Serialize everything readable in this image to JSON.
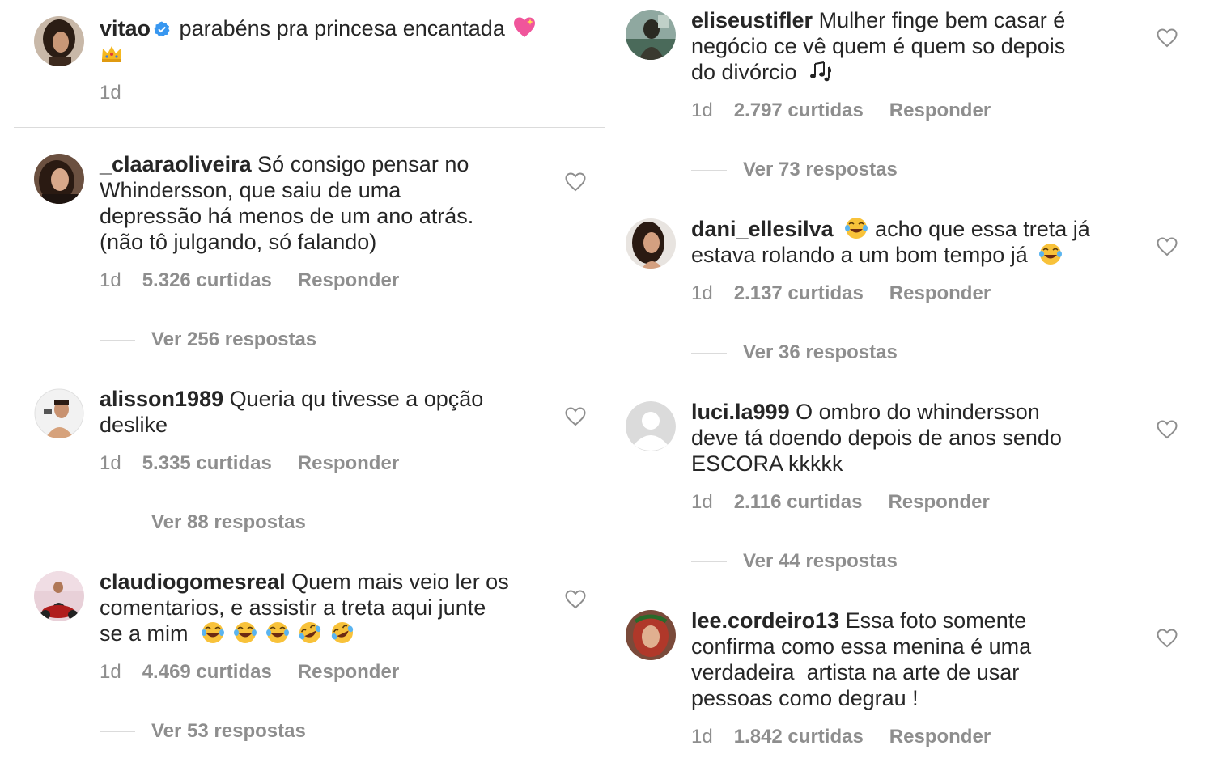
{
  "caption": {
    "username": "vitao",
    "text": "parabéns pra princesa encantada",
    "time": "1d"
  },
  "left_comments": [
    {
      "username": "_claaraoliveira",
      "text_lines": [
        "Só consigo pensar no",
        "Whindersson, que saiu de uma",
        "depressão há menos de um ano atrás.",
        "(não tô julgando, só falando)"
      ],
      "time": "1d",
      "likes": "5.326 curtidas",
      "reply": "Responder",
      "replies": "Ver 256 respostas"
    },
    {
      "username": "alisson1989",
      "text_lines": [
        "Queria qu tivesse a opção",
        "deslike"
      ],
      "time": "1d",
      "likes": "5.335 curtidas",
      "reply": "Responder",
      "replies": "Ver 88 respostas"
    },
    {
      "username": "claudiogomesreal",
      "text_lines": [
        "Quem mais veio ler os",
        "comentarios, e assistir a treta aqui junte",
        "se a mim"
      ],
      "time": "1d",
      "likes": "4.469 curtidas",
      "reply": "Responder",
      "replies": "Ver 53 respostas"
    }
  ],
  "right_comments": [
    {
      "username": "eliseustifler",
      "text_lines": [
        "Mulher finge bem casar é",
        "negócio ce vê quem é quem so depois",
        "do divórcio"
      ],
      "time": "1d",
      "likes": "2.797 curtidas",
      "reply": "Responder",
      "replies": "Ver 73 respostas"
    },
    {
      "username": "dani_ellesilva",
      "text_lines": [
        "acho que essa treta já",
        "estava rolando a um bom tempo já"
      ],
      "time": "1d",
      "likes": "2.137 curtidas",
      "reply": "Responder",
      "replies": "Ver 36 respostas"
    },
    {
      "username": "luci.la999",
      "text_lines": [
        "O ombro do whindersson",
        "deve tá doendo depois de anos sendo",
        "ESCORA kkkkk"
      ],
      "time": "1d",
      "likes": "2.116 curtidas",
      "reply": "Responder",
      "replies": "Ver 44 respostas"
    },
    {
      "username": "lee.cordeiro13",
      "text_lines": [
        "Essa foto somente",
        "confirma como essa menina é uma",
        "verdadeira  artista na arte de usar",
        "pessoas como degrau !"
      ],
      "time": "1d",
      "likes": "1.842 curtidas",
      "reply": "Responder"
    }
  ],
  "icons": {
    "verified": "verified-badge-icon",
    "heart": "heart-outline-icon",
    "emoji_heart": "sparkling-heart-emoji",
    "emoji_crown": "crown-emoji",
    "emoji_laugh": "tears-of-joy-emoji",
    "emoji_rofl": "rolling-laughing-emoji",
    "emoji_notes": "musical-notes-emoji"
  },
  "colors": {
    "text": "#262626",
    "secondary": "#8e8e8e",
    "verified": "#3897f0",
    "divider": "#dbdbdb"
  }
}
